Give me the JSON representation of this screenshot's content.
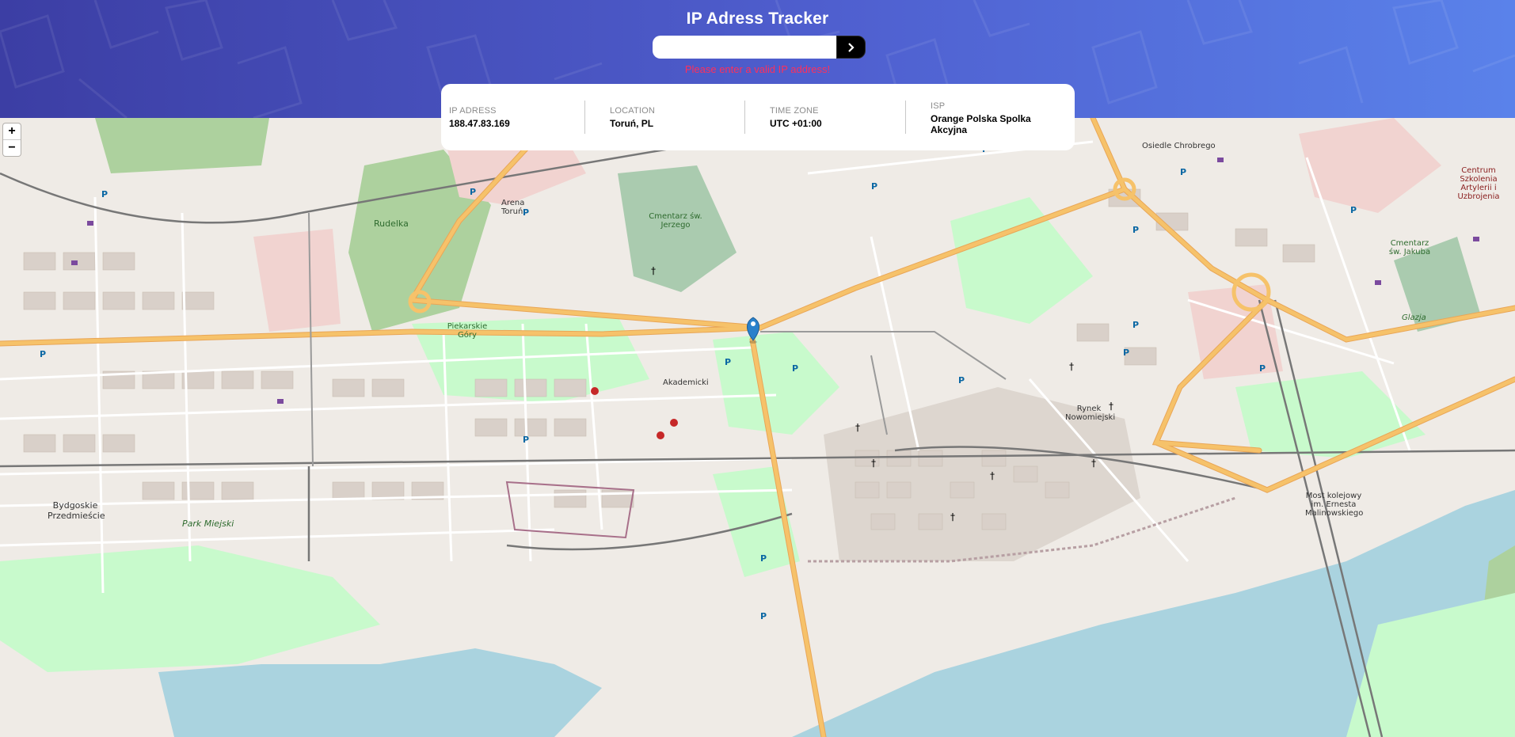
{
  "app": {
    "title": "IP Adress Tracker"
  },
  "search": {
    "value": "",
    "placeholder": "",
    "submit_icon": "chevron-right-icon",
    "error": "Please enter a valid IP address!"
  },
  "info": {
    "ip": {
      "label": "IP ADRESS",
      "value": "188.47.83.169"
    },
    "location": {
      "label": "LOCATION",
      "value": "Toruń, PL"
    },
    "timezone": {
      "label": "TIME ZONE",
      "value": "UTC +01:00"
    },
    "isp": {
      "label": "ISP",
      "value": "Orange Polska Spolka Akcyjna"
    }
  },
  "map": {
    "zoom_in": "+",
    "zoom_out": "−",
    "marker_icon": "map-pin-icon",
    "labels": {
      "rudelka": "Rudelka",
      "arena": "Arena Toruń",
      "cmentarz_jerzego": "Cmentarz św. Jerzego",
      "piekarskie_gory": "Piekarskie Góry",
      "rynek": "Rynek Nowomiejski",
      "bydgoskie": "Bydgoskie Przedmieście",
      "park_miejski": "Park Miejski",
      "centrum_szkolenia": "Centrum Szkolenia Artylerii i Uzbrojenia",
      "most": "Most kolejowy im. Ernesta Malinowskiego",
      "glazja": "Glazja",
      "cmentarz_jakuba": "Cmentarz św. Jakuba",
      "akademicki": "Akademicki",
      "osiedle_chrobrego": "Osiedle Chrobrego"
    },
    "colors": {
      "water": "#aad3df",
      "park": "#c8facc",
      "forest": "#add19e",
      "cemetery": "#aacbaf",
      "major_road": "#f6c26a",
      "residential": "#e0dfdf",
      "buildings": "#d9d0c9",
      "railway": "#777777",
      "marker": "#2a81cb"
    }
  }
}
